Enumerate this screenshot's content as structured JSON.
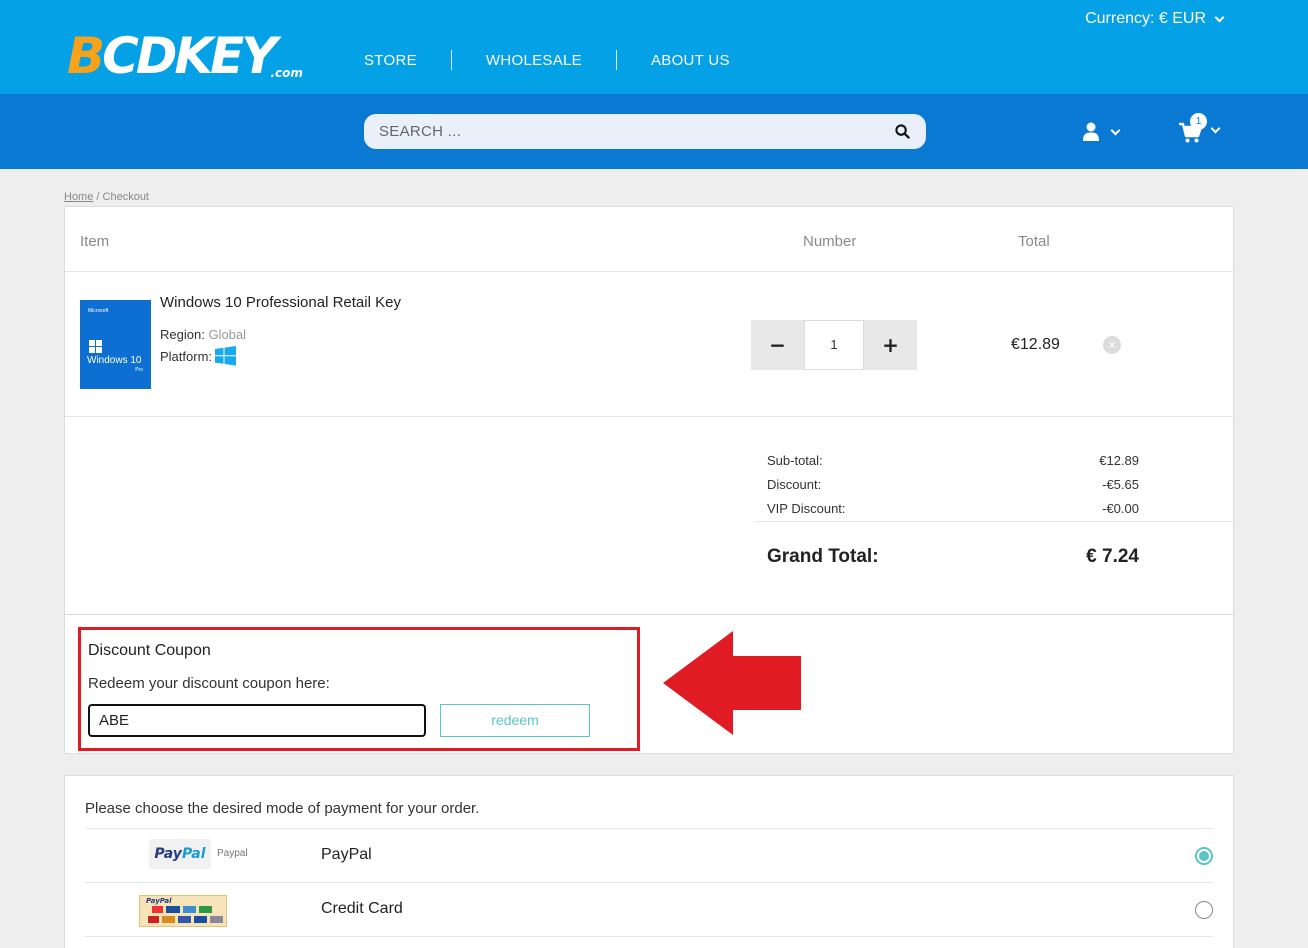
{
  "brand": {
    "logo_main": "BCDKEY",
    "logo_suffix": ".com",
    "colors": {
      "primary": "#04a1e6",
      "secondary": "#0a79d3",
      "accent": "#5bc4c4",
      "highlight": "#e01b24",
      "logo_b": "#f7a21b"
    }
  },
  "header": {
    "nav": [
      {
        "label": "STORE"
      },
      {
        "label": "WHOLESALE"
      },
      {
        "label": "ABOUT US"
      }
    ],
    "currency_label": "Currency: € EUR",
    "search_placeholder": "SEARCH ...",
    "cart_count": "1",
    "icons": {
      "search": "search-icon",
      "user": "user-icon",
      "cart": "cart-icon"
    }
  },
  "breadcrumb": {
    "home": "Home",
    "separator": " / ",
    "current": "Checkout"
  },
  "cart": {
    "columns": {
      "item": "Item",
      "number": "Number",
      "total": "Total"
    },
    "items": [
      {
        "name": "Windows 10 Professional Retail Key",
        "region_label": "Region:",
        "region_value": "Global",
        "platform_label": "Platform:",
        "platform_icon": "windows-icon",
        "image_small_text": "Microsoft",
        "image_title": "Windows 10",
        "image_subtitle": "Pro",
        "quantity": "1",
        "minus_label": "−",
        "plus_label": "+",
        "total": "€12.89"
      }
    ],
    "summary": {
      "subtotal_label": "Sub-total:",
      "subtotal_value": "€12.89",
      "discount_label": "Discount:",
      "discount_value": "-€5.65",
      "vip_label": "VIP Discount:",
      "vip_value": "-€0.00",
      "grand_label": "Grand Total:",
      "grand_value": "€ 7.24"
    }
  },
  "coupon": {
    "title": "Discount Coupon",
    "subtitle": "Redeem your discount coupon here:",
    "input_value": "ABE",
    "redeem_label": "redeem"
  },
  "payment": {
    "title": "Please choose the desired mode of payment for your order.",
    "methods": [
      {
        "name": "PayPal",
        "logo_small": "Paypal",
        "logo_part1": "Pay",
        "logo_part2": "Pal",
        "selected": true
      },
      {
        "name": "Credit Card",
        "logo_small": "PayPal",
        "selected": false
      }
    ]
  }
}
